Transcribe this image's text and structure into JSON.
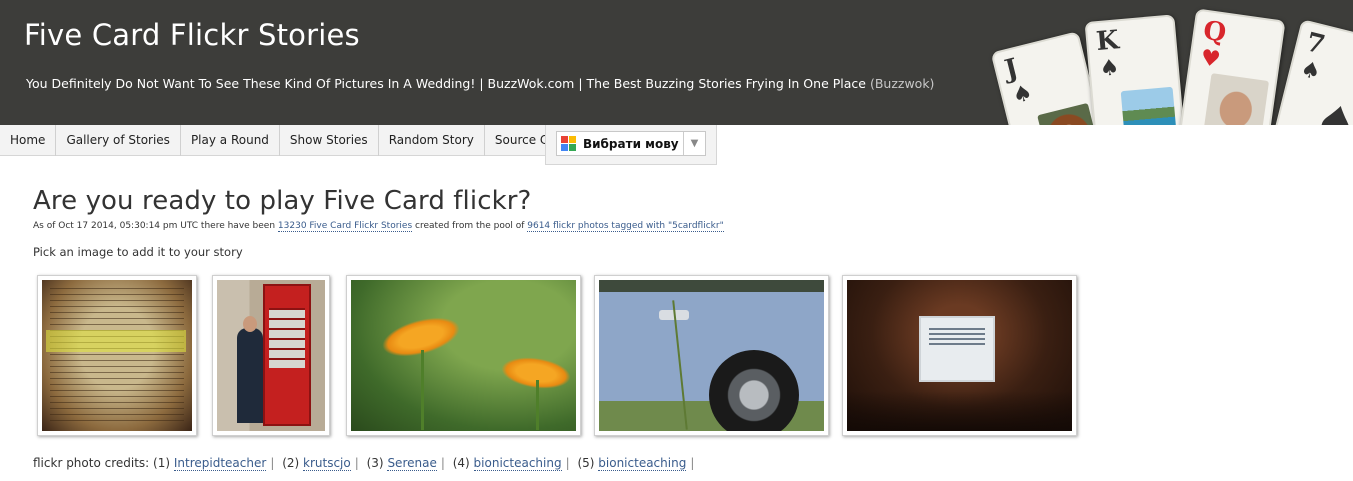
{
  "header": {
    "title": "Five Card Flickr Stories",
    "tagline": {
      "part1": "You Definitely Do Not Want To See These Kind Of Pictures In A Wedding!",
      "sep": "|",
      "part2": "BuzzWok.com",
      "part3": "The Best Buzzing Stories Frying In One Place",
      "source": "(Buzzwok)"
    }
  },
  "cards": [
    {
      "rank": "J",
      "suit": "♠",
      "color": "#111111",
      "icon": "puppy-photo"
    },
    {
      "rank": "K",
      "suit": "♠",
      "color": "#111111",
      "icon": "beach-photo"
    },
    {
      "rank": "Q",
      "suit": "♥",
      "color": "#d8262c",
      "icon": "man-with-sunglasses-photo"
    },
    {
      "rank": "7",
      "suit": "♠",
      "color": "#111111",
      "icon": "spade-pips"
    }
  ],
  "nav": {
    "items": [
      "Home",
      "Gallery of Stories",
      "Play a Round",
      "Show Stories",
      "Random Story",
      "Source Code"
    ],
    "language_select": "Вибрати мову"
  },
  "main": {
    "title": "Are you ready to play Five Card flickr?",
    "stats": {
      "prefix": "As of Oct 17 2014, 05:30:14 pm UTC there have been",
      "stories_link": "13230 Five Card Flickr Stories",
      "middle": "created from the pool of",
      "photos_link": "9614 flickr photos tagged with \"5cardflickr\""
    },
    "instruction": "Pick an image to add it to your story",
    "photos": [
      {
        "name": "book-page-photo",
        "subject": "book page"
      },
      {
        "name": "phone-box-photo",
        "subject": "man by red telephone box"
      },
      {
        "name": "orange-flowers-photo",
        "subject": "orange flowers"
      },
      {
        "name": "blue-car-photo",
        "subject": "blue car wheel"
      },
      {
        "name": "presentation-photo",
        "subject": "presentation screen"
      }
    ],
    "credits": {
      "label": "flickr photo credits:",
      "items": [
        {
          "num": "(1)",
          "name": "Intrepidteacher"
        },
        {
          "num": "(2)",
          "name": "krutscjo"
        },
        {
          "num": "(3)",
          "name": "Serenae"
        },
        {
          "num": "(4)",
          "name": "bionicteaching"
        },
        {
          "num": "(5)",
          "name": "bionicteaching"
        }
      ],
      "separator": "|"
    }
  }
}
